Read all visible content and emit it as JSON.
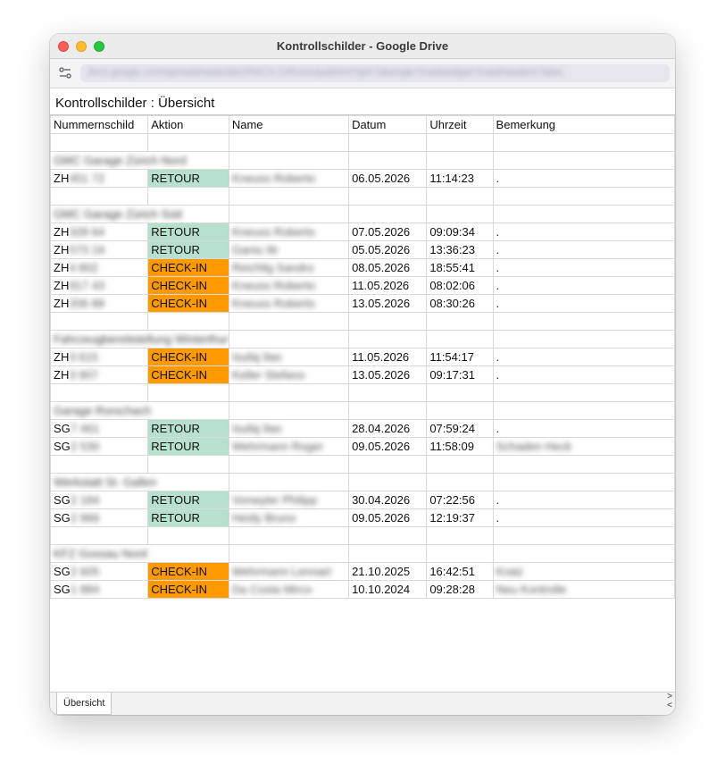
{
  "window": {
    "title": "Kontrollschilder - Google Drive"
  },
  "urlbar": {
    "url": "docs.google.com/spreadsheets/d/e/2PACX-1vRxxxx/pubhtml?gid=0&single=true&widget=true&headers=false"
  },
  "sheet": {
    "title": "Kontrollschilder : Übersicht"
  },
  "table": {
    "headers": [
      "Nummernschild",
      "Aktion",
      "Name",
      "Datum",
      "Uhrzeit",
      "Bemerkung"
    ],
    "rows": [
      {
        "type": "empty"
      },
      {
        "type": "group",
        "label": "GMC Garage Zürich Nord"
      },
      {
        "type": "data",
        "plate": "ZH",
        "plate_rest": "451 72",
        "action": "RETOUR",
        "name": "Kneuss Roberto",
        "date": "06.05.2026",
        "time": "11:14:23",
        "remark": "."
      },
      {
        "type": "empty"
      },
      {
        "type": "group",
        "label": "GMC Garage Zürich Süd"
      },
      {
        "type": "data",
        "plate": "ZH",
        "plate_rest": "328 64",
        "action": "RETOUR",
        "name": "Kneuss Roberto",
        "date": "07.05.2026",
        "time": "09:09:34",
        "remark": "."
      },
      {
        "type": "data",
        "plate": "ZH",
        "plate_rest": "573 19",
        "action": "RETOUR",
        "name": "Ganiu Ilir",
        "date": "05.05.2026",
        "time": "13:36:23",
        "remark": "."
      },
      {
        "type": "data",
        "plate": "ZH",
        "plate_rest": "4 802",
        "action": "CHECK-IN",
        "name": "Reichlig Sandro",
        "date": "08.05.2026",
        "time": "18:55:41",
        "remark": "."
      },
      {
        "type": "data",
        "plate": "ZH",
        "plate_rest": "917 43",
        "action": "CHECK-IN",
        "name": "Kneuss Roberto",
        "date": "11.05.2026",
        "time": "08:02:06",
        "remark": "."
      },
      {
        "type": "data",
        "plate": "ZH",
        "plate_rest": "206 88",
        "action": "CHECK-IN",
        "name": "Kneuss Roberto",
        "date": "13.05.2026",
        "time": "08:30:26",
        "remark": "."
      },
      {
        "type": "empty"
      },
      {
        "type": "group",
        "label": "Fahrzeugbereitstellung Winterthur"
      },
      {
        "type": "data",
        "plate": "ZH",
        "plate_rest": "3 615",
        "action": "CHECK-IN",
        "name": "Isufaj Ilan",
        "date": "11.05.2026",
        "time": "11:54:17",
        "remark": "."
      },
      {
        "type": "data",
        "plate": "ZH",
        "plate_rest": "3 907",
        "action": "CHECK-IN",
        "name": "Keller Stefano",
        "date": "13.05.2026",
        "time": "09:17:31",
        "remark": "."
      },
      {
        "type": "empty"
      },
      {
        "type": "group",
        "label": "Garage Rorschach"
      },
      {
        "type": "data",
        "plate": "SG",
        "plate_rest": "7 461",
        "action": "RETOUR",
        "name": "Isufaj Ilan",
        "date": "28.04.2026",
        "time": "07:59:24",
        "remark": "."
      },
      {
        "type": "data",
        "plate": "SG",
        "plate_rest": "2 530",
        "action": "RETOUR",
        "name": "Wehrmann Roger",
        "date": "09.05.2026",
        "time": "11:58:09",
        "remark": "Schaden Heck"
      },
      {
        "type": "empty"
      },
      {
        "type": "group",
        "label": "Werkstatt St. Gallen"
      },
      {
        "type": "data",
        "plate": "SG",
        "plate_rest": "2 184",
        "action": "RETOUR",
        "name": "Vonwyler Philipp",
        "date": "30.04.2026",
        "time": "07:22:56",
        "remark": "."
      },
      {
        "type": "data",
        "plate": "SG",
        "plate_rest": "2 966",
        "action": "RETOUR",
        "name": "Heidy Bruno",
        "date": "09.05.2026",
        "time": "12:19:37",
        "remark": "."
      },
      {
        "type": "empty"
      },
      {
        "type": "group",
        "label": "KFZ Gossau Nord"
      },
      {
        "type": "data",
        "plate": "SG",
        "plate_rest": "2 605",
        "action": "CHECK-IN",
        "name": "Wehrmann Lennart",
        "date": "21.10.2025",
        "time": "16:42:51",
        "remark": "Kratz"
      },
      {
        "type": "data",
        "plate": "SG",
        "plate_rest": "1 884",
        "action": "CHECK-IN",
        "name": "Da Costa Mirco",
        "date": "10.10.2024",
        "time": "09:28:28",
        "remark": "Neu Kontrolle"
      }
    ]
  },
  "tabs": {
    "active": "Übersicht",
    "scroll_right": ">",
    "scroll_left": "<"
  },
  "colors": {
    "retour": "#b7e1cd",
    "checkin": "#ff9900"
  }
}
